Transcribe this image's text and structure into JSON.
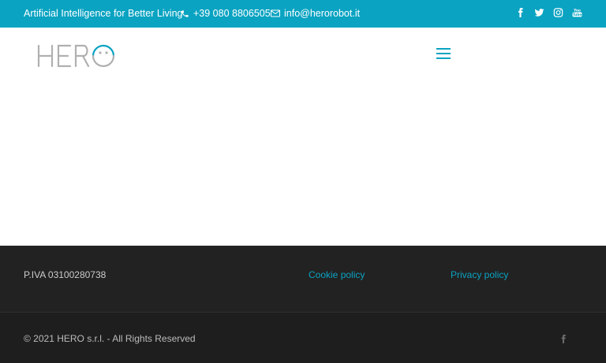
{
  "topbar": {
    "tagline": "Artificial Intelligence for Better Living",
    "phone": "+39 080 8806505",
    "email": "info@herorobot.it",
    "social_icons": [
      "facebook-icon",
      "twitter-icon",
      "instagram-icon",
      "youtube-icon"
    ]
  },
  "header": {
    "logo_text": "HERO",
    "menu_icon": "hamburger-menu-icon"
  },
  "footer": {
    "piva": "P.IVA 03100280738",
    "cookie_policy": "Cookie policy",
    "privacy_policy": "Privacy policy",
    "copyright": "© 2021 HERO s.r.l. - All Rights Reserved",
    "social_icon": "facebook-icon"
  },
  "colors": {
    "accent": "#0aa3c2",
    "footer_bg": "#222222",
    "footer_bottom_bg": "#1e1e1e",
    "logo_gray": "#b0b0b0"
  }
}
